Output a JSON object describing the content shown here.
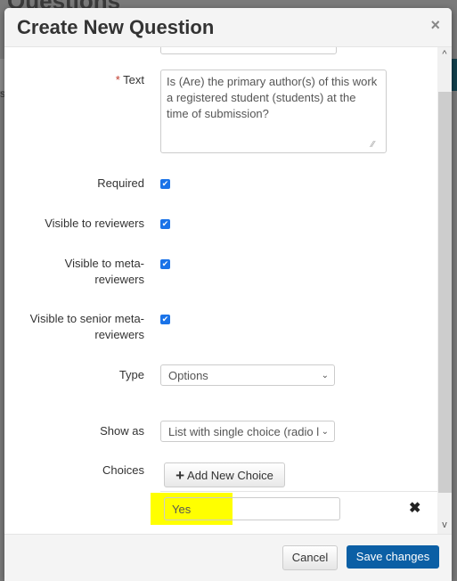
{
  "backdrop": {
    "page_title": "Questions",
    "tab_fragment": "s"
  },
  "modal": {
    "title": "Create New Question",
    "close_symbol": "×"
  },
  "form": {
    "text": {
      "label": "Text",
      "required_marker": "*",
      "value": "Is (Are) the primary author(s) of this work a registered student (students) at the time of submission?"
    },
    "required": {
      "label": "Required",
      "checked": true
    },
    "visible_reviewers": {
      "label": "Visible to reviewers",
      "checked": true
    },
    "visible_meta": {
      "label_line1": "Visible to meta-",
      "label_line2": "reviewers",
      "checked": true
    },
    "visible_senior_meta": {
      "label_line1": "Visible to senior meta-",
      "label_line2": "reviewers",
      "checked": true
    },
    "type": {
      "label": "Type",
      "value": "Options"
    },
    "show_as": {
      "label": "Show as",
      "value": "List with single choice (radio l"
    },
    "choices": {
      "label": "Choices",
      "add_button": "Add New Choice",
      "items": [
        {
          "value": "Yes"
        }
      ]
    }
  },
  "footer": {
    "cancel": "Cancel",
    "save": "Save changes"
  },
  "icons": {
    "check": "✔",
    "chevron": "⌄",
    "plus": "+",
    "remove": "✖",
    "scroll_up": "^",
    "scroll_down": "v",
    "grip": "⁄⁄"
  },
  "colors": {
    "primary": "#0b5fa5",
    "checkbox": "#1a73e8",
    "highlight": "#ffff00"
  }
}
